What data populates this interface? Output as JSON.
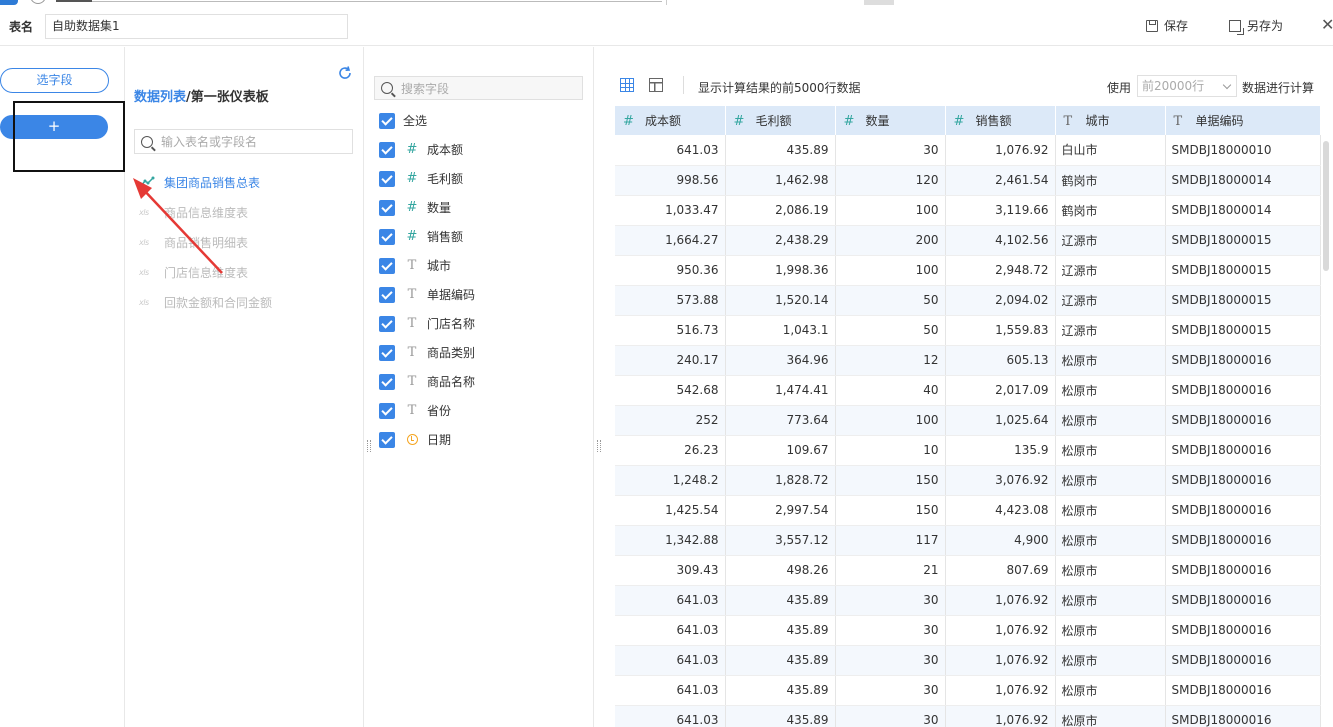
{
  "header": {
    "table_name_label": "表名",
    "table_name_value": "自助数据集1",
    "save_label": "保存",
    "save_as_label": "另存为",
    "close_glyph": "✕"
  },
  "left": {
    "pick_fields_label": "选字段",
    "plus_label": "+"
  },
  "tables": {
    "breadcrumb_link": "数据列表",
    "breadcrumb_sep": "/",
    "breadcrumb_current": "第一张仪表板",
    "search_placeholder": "输入表名或字段名",
    "items": [
      {
        "label": "集团商品销售总表",
        "icon": "chart-line-icon",
        "active": true
      },
      {
        "label": "商品信息维度表",
        "icon": "xls-icon",
        "active": false
      },
      {
        "label": "商品销售明细表",
        "icon": "xls-icon",
        "active": false
      },
      {
        "label": "门店信息维度表",
        "icon": "xls-icon",
        "active": false
      },
      {
        "label": "回款金额和合同金额",
        "icon": "xls-icon",
        "active": false
      }
    ]
  },
  "fields": {
    "search_placeholder": "搜索字段",
    "select_all_label": "全选",
    "items": [
      {
        "label": "成本额",
        "type": "#"
      },
      {
        "label": "毛利额",
        "type": "#"
      },
      {
        "label": "数量",
        "type": "#"
      },
      {
        "label": "销售额",
        "type": "#"
      },
      {
        "label": "城市",
        "type": "T"
      },
      {
        "label": "单据编码",
        "type": "T"
      },
      {
        "label": "门店名称",
        "type": "T"
      },
      {
        "label": "商品类别",
        "type": "T"
      },
      {
        "label": "商品名称",
        "type": "T"
      },
      {
        "label": "省份",
        "type": "T"
      },
      {
        "label": "日期",
        "type": "date"
      }
    ]
  },
  "preview": {
    "info_text": "显示计算结果的前5000行数据",
    "use_label": "使用",
    "rows_select_value": "前20000行",
    "calc_label": "数据进行计算",
    "columns": [
      {
        "label": "成本额",
        "type": "#"
      },
      {
        "label": "毛利额",
        "type": "#"
      },
      {
        "label": "数量",
        "type": "#"
      },
      {
        "label": "销售额",
        "type": "#"
      },
      {
        "label": "城市",
        "type": "T"
      },
      {
        "label": "单据编码",
        "type": "T"
      }
    ],
    "rows": [
      [
        "641.03",
        "435.89",
        "30",
        "1,076.92",
        "白山市",
        "SMDBJ18000010"
      ],
      [
        "998.56",
        "1,462.98",
        "120",
        "2,461.54",
        "鹤岗市",
        "SMDBJ18000014"
      ],
      [
        "1,033.47",
        "2,086.19",
        "100",
        "3,119.66",
        "鹤岗市",
        "SMDBJ18000014"
      ],
      [
        "1,664.27",
        "2,438.29",
        "200",
        "4,102.56",
        "辽源市",
        "SMDBJ18000015"
      ],
      [
        "950.36",
        "1,998.36",
        "100",
        "2,948.72",
        "辽源市",
        "SMDBJ18000015"
      ],
      [
        "573.88",
        "1,520.14",
        "50",
        "2,094.02",
        "辽源市",
        "SMDBJ18000015"
      ],
      [
        "516.73",
        "1,043.1",
        "50",
        "1,559.83",
        "辽源市",
        "SMDBJ18000015"
      ],
      [
        "240.17",
        "364.96",
        "12",
        "605.13",
        "松原市",
        "SMDBJ18000016"
      ],
      [
        "542.68",
        "1,474.41",
        "40",
        "2,017.09",
        "松原市",
        "SMDBJ18000016"
      ],
      [
        "252",
        "773.64",
        "100",
        "1,025.64",
        "松原市",
        "SMDBJ18000016"
      ],
      [
        "26.23",
        "109.67",
        "10",
        "135.9",
        "松原市",
        "SMDBJ18000016"
      ],
      [
        "1,248.2",
        "1,828.72",
        "150",
        "3,076.92",
        "松原市",
        "SMDBJ18000016"
      ],
      [
        "1,425.54",
        "2,997.54",
        "150",
        "4,423.08",
        "松原市",
        "SMDBJ18000016"
      ],
      [
        "1,342.88",
        "3,557.12",
        "117",
        "4,900",
        "松原市",
        "SMDBJ18000016"
      ],
      [
        "309.43",
        "498.26",
        "21",
        "807.69",
        "松原市",
        "SMDBJ18000016"
      ],
      [
        "641.03",
        "435.89",
        "30",
        "1,076.92",
        "松原市",
        "SMDBJ18000016"
      ],
      [
        "641.03",
        "435.89",
        "30",
        "1,076.92",
        "松原市",
        "SMDBJ18000016"
      ],
      [
        "641.03",
        "435.89",
        "30",
        "1,076.92",
        "松原市",
        "SMDBJ18000016"
      ],
      [
        "641.03",
        "435.89",
        "30",
        "1,076.92",
        "松原市",
        "SMDBJ18000016"
      ],
      [
        "641.03",
        "435.89",
        "30",
        "1,076.92",
        "松原市",
        "SMDBJ18000016"
      ]
    ]
  },
  "colors": {
    "accent": "#3b86e6",
    "number_icon": "#34a6a0",
    "date_icon": "#f5a623",
    "header_bg": "#dce9f8",
    "annotation_arrow": "#e53935"
  }
}
